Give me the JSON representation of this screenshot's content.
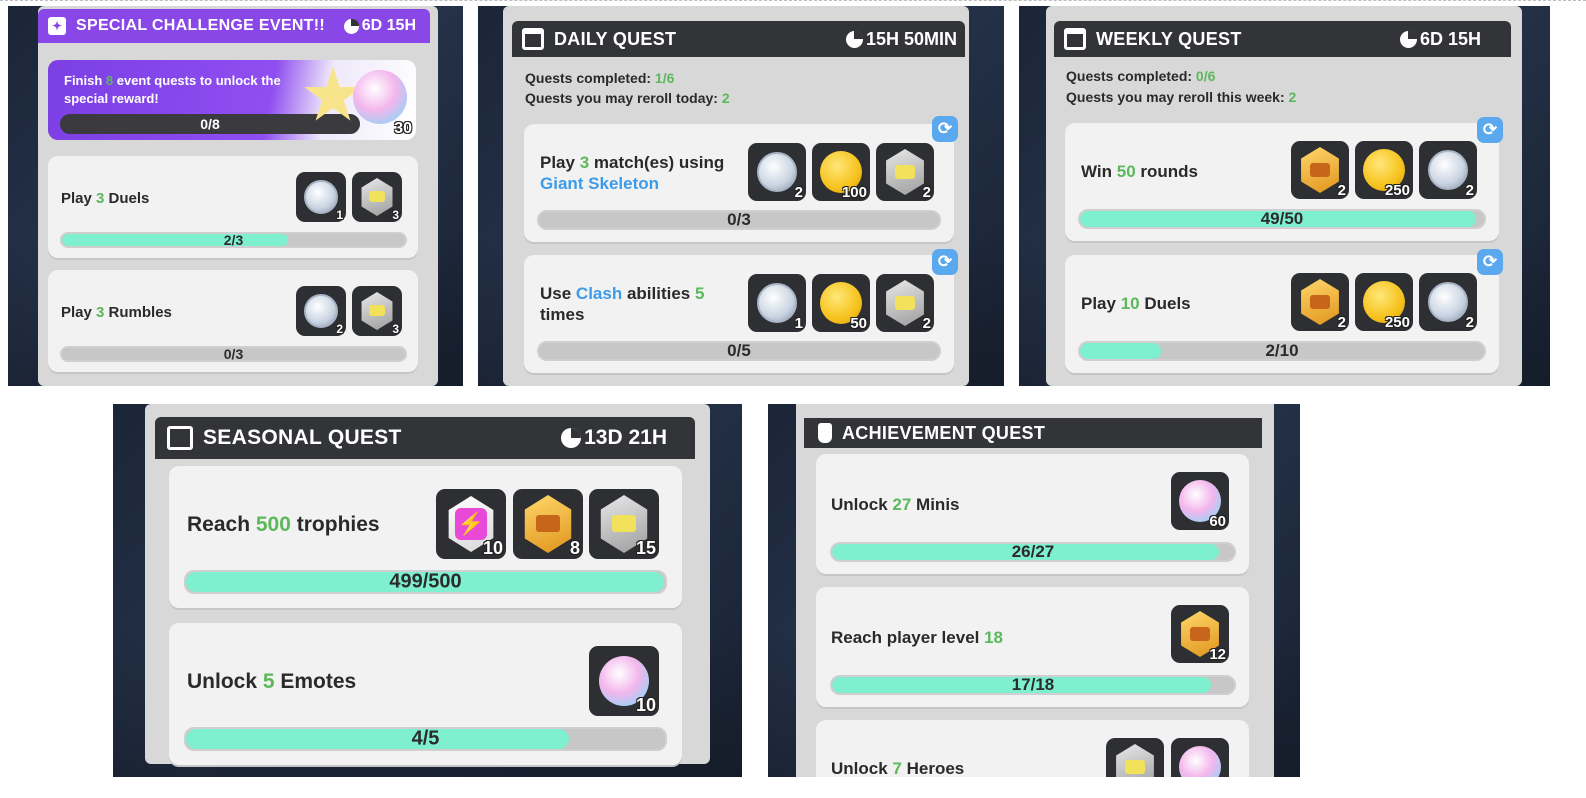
{
  "special": {
    "title": "SPECIAL CHALLENGE EVENT!!",
    "timer": "6D 15H",
    "banner_pre": "Finish ",
    "banner_num": "8",
    "banner_post": " event quests to unlock the special reward!",
    "banner_progress": "0/8",
    "banner_progress_value": 0,
    "banner_reward": "30",
    "quests": [
      {
        "pre": "Play ",
        "num": "3",
        "post": " Duels",
        "progress": "2/3",
        "value": 0.66,
        "rewards": [
          "1",
          "3"
        ]
      },
      {
        "pre": "Play ",
        "num": "3",
        "post": " Rumbles",
        "progress": "0/3",
        "value": 0,
        "rewards": [
          "2",
          "3"
        ]
      }
    ]
  },
  "daily": {
    "title": "DAILY QUEST",
    "timer": "15H 50MIN",
    "completed_label": "Quests completed: ",
    "completed_value": "1/6",
    "reroll_label": "Quests you may reroll today: ",
    "reroll_value": "2",
    "quests": [
      {
        "pre": "Play ",
        "num": "3",
        "mid": " match(es) using",
        "blue": "Giant Skeleton",
        "progress": "0/3",
        "value": 0,
        "rewards": [
          "2",
          "100",
          "2"
        ]
      },
      {
        "pre": "Use ",
        "blue": "Clash",
        "mid": " abilities ",
        "num": "5",
        "post": "times",
        "progress": "0/5",
        "value": 0,
        "rewards": [
          "1",
          "50",
          "2"
        ]
      }
    ]
  },
  "weekly": {
    "title": "WEEKLY QUEST",
    "timer": "6D 15H",
    "completed_label": "Quests completed: ",
    "completed_value": "0/6",
    "reroll_label": "Quests you may reroll this week: ",
    "reroll_value": "2",
    "quests": [
      {
        "pre": "Win ",
        "num": "50",
        "post": " rounds",
        "progress": "49/50",
        "value": 0.98,
        "rewards": [
          "2",
          "250",
          "2"
        ]
      },
      {
        "pre": "Play ",
        "num": "10",
        "post": " Duels",
        "progress": "2/10",
        "value": 0.2,
        "rewards": [
          "2",
          "250",
          "2"
        ]
      }
    ]
  },
  "seasonal": {
    "title": "SEASONAL QUEST",
    "timer": "13D 21H",
    "quests": [
      {
        "pre": "Reach ",
        "num": "500",
        "post": " trophies",
        "progress": "499/500",
        "value": 0.998,
        "rewards": [
          "10",
          "8",
          "15"
        ]
      },
      {
        "pre": "Unlock ",
        "num": "5",
        "post": " Emotes",
        "progress": "4/5",
        "value": 0.8,
        "rewards": [
          "10"
        ]
      }
    ]
  },
  "achievement": {
    "title": "ACHIEVEMENT QUEST",
    "quests": [
      {
        "pre": "Unlock ",
        "num": "27",
        "post": " Minis",
        "progress": "26/27",
        "value": 0.963,
        "rewards": [
          "60"
        ]
      },
      {
        "pre": "Reach player level ",
        "num": "18",
        "post": "",
        "progress": "17/18",
        "value": 0.944,
        "rewards": [
          "12"
        ]
      },
      {
        "pre": "Unlock ",
        "num": "7",
        "post": " Heroes"
      }
    ]
  },
  "colors": {
    "accent_green": "#5cb85c",
    "link_blue": "#3d9be9",
    "progress_fill": "#7ff0cf",
    "event_purple": "#8a47e8"
  }
}
